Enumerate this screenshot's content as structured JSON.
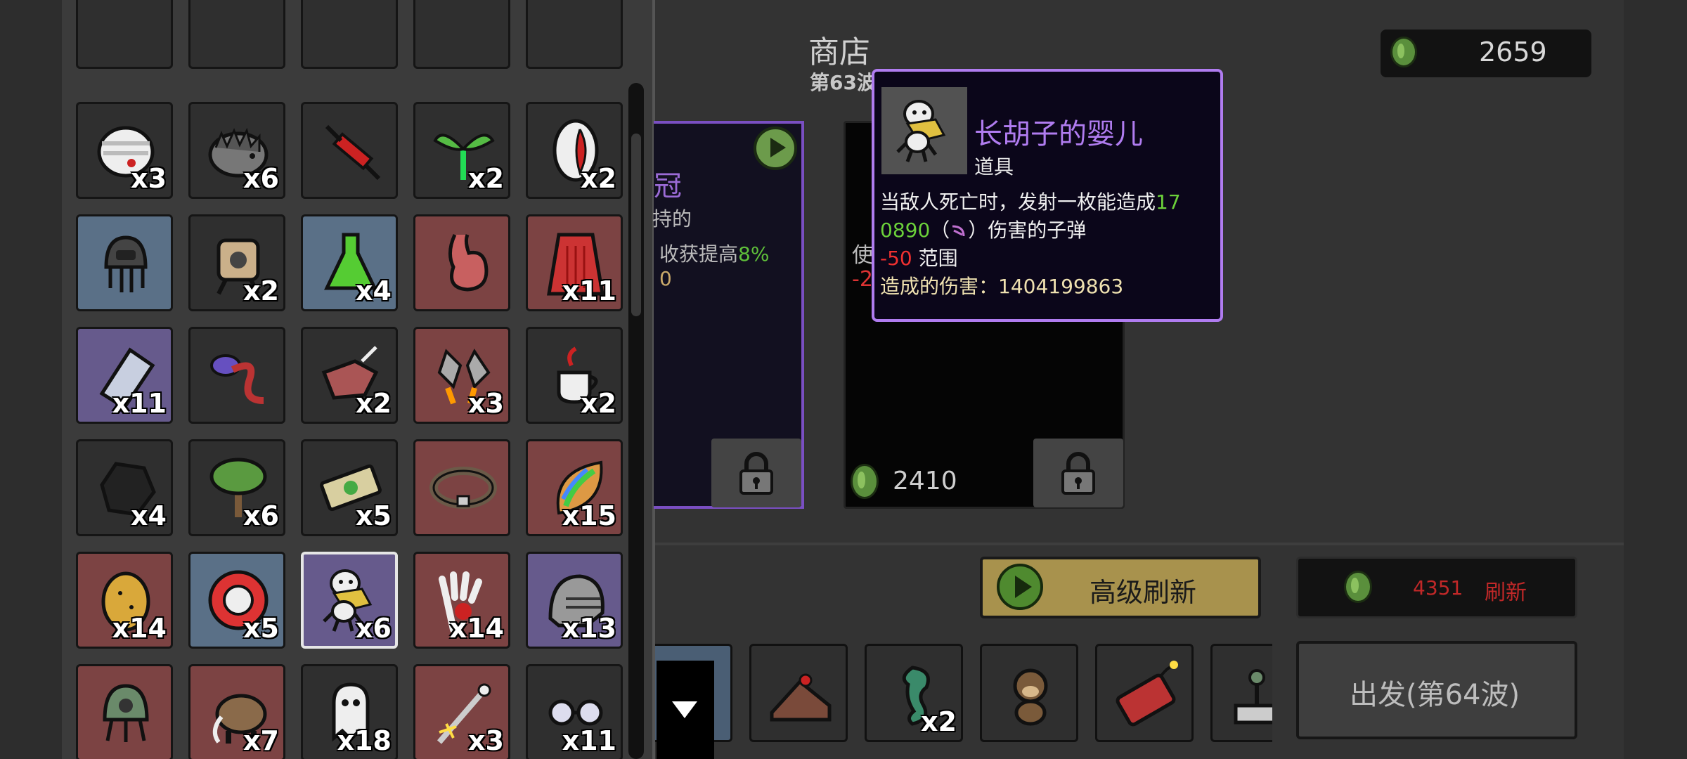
{
  "shop": {
    "title": "商店",
    "wave_label": "第63波",
    "money": "2659"
  },
  "inventory": {
    "rows": [
      [
        {
          "icon": "bandaged-head-icon",
          "color": "gray",
          "count": "x3"
        },
        {
          "icon": "hedgehog-icon",
          "color": "gray",
          "count": "x6"
        },
        {
          "icon": "syringe-icon",
          "color": "gray",
          "count": ""
        },
        {
          "icon": "sprout-icon",
          "color": "gray",
          "count": "x2"
        },
        {
          "icon": "monster-mouth-icon",
          "color": "gray",
          "count": "x2"
        }
      ],
      [
        {
          "icon": "robot-walker-icon",
          "color": "blue",
          "count": ""
        },
        {
          "icon": "turret-icon",
          "color": "gray",
          "count": "x2"
        },
        {
          "icon": "potion-flask-icon",
          "color": "blue",
          "count": "x4"
        },
        {
          "icon": "stomach-icon",
          "color": "red",
          "count": ""
        },
        {
          "icon": "cape-icon",
          "color": "red",
          "count": "x11"
        }
      ],
      [
        {
          "icon": "crystal-block-icon",
          "color": "purple",
          "count": "x11"
        },
        {
          "icon": "tongue-icon",
          "color": "gray",
          "count": ""
        },
        {
          "icon": "meat-icon",
          "color": "gray",
          "count": "x2"
        },
        {
          "icon": "rockets-icon",
          "color": "red",
          "count": "x3"
        },
        {
          "icon": "coffee-cup-icon",
          "color": "gray",
          "count": "x2"
        }
      ],
      [
        {
          "icon": "coal-rock-icon",
          "color": "gray",
          "count": "x4"
        },
        {
          "icon": "tree-icon",
          "color": "gray",
          "count": "x6"
        },
        {
          "icon": "banknote-icon",
          "color": "gray",
          "count": "x5"
        },
        {
          "icon": "collar-icon",
          "color": "red",
          "count": ""
        },
        {
          "icon": "rainbow-leaf-icon",
          "color": "red",
          "count": "x15"
        }
      ],
      [
        {
          "icon": "potato-icon",
          "color": "red",
          "count": "x14"
        },
        {
          "icon": "target-ring-icon",
          "color": "blue",
          "count": "x5"
        },
        {
          "icon": "bearded-baby-icon",
          "color": "purple",
          "count": "x6",
          "selected": true
        },
        {
          "icon": "bloody-hand-icon",
          "color": "red",
          "count": "x14"
        },
        {
          "icon": "knight-helmet-icon",
          "color": "purple",
          "count": "x13"
        }
      ],
      [
        {
          "icon": "dome-drone-icon",
          "color": "red",
          "count": ""
        },
        {
          "icon": "mammoth-icon",
          "color": "red",
          "count": "x7"
        },
        {
          "icon": "ghost-icon",
          "color": "gray",
          "count": "x18"
        },
        {
          "icon": "wand-icon",
          "color": "red",
          "count": "x3"
        },
        {
          "icon": "goggles-icon",
          "color": "gray",
          "count": "x11"
        }
      ]
    ]
  },
  "card1": {
    "name_fragment": "冠",
    "line1": "持的",
    "line2_prefix": "收获提高",
    "line2_value": "8%",
    "line3": "0"
  },
  "card2": {
    "partial1": "使",
    "partial2": "-2",
    "price": "2410"
  },
  "tooltip": {
    "name": "长胡子的婴儿",
    "type": "道具",
    "desc_prefix": "当敌人死亡时，发射一枚能造成",
    "desc_num_a": "17",
    "desc_num_b": "0890",
    "desc_suffix": "（",
    "desc_suffix2": "）伤害的子弹",
    "range_value": "-50",
    "range_label": " 范围",
    "damage_label": "造成的伤害：",
    "damage_value": "1404199863",
    "icon": "bearded-baby-icon"
  },
  "buttons": {
    "advanced_refresh": "高级刷新",
    "refresh_cost": "4351",
    "refresh": "刷新",
    "start": "出发(第64波)"
  },
  "bottom_items": [
    {
      "icon": "mug-icon",
      "count": ""
    },
    {
      "icon": "cake-slice-icon",
      "count": ""
    },
    {
      "icon": "seahorse-icon",
      "count": "x2"
    },
    {
      "icon": "monkey-icon",
      "count": ""
    },
    {
      "icon": "dynamite-icon",
      "count": ""
    },
    {
      "icon": "joystick-icon",
      "count": ""
    }
  ],
  "colors": {
    "accent_purple": "#b07cf0",
    "positive_green": "#6bd03a",
    "negative_red": "#f03030",
    "refresh_gold": "#a8924d"
  }
}
